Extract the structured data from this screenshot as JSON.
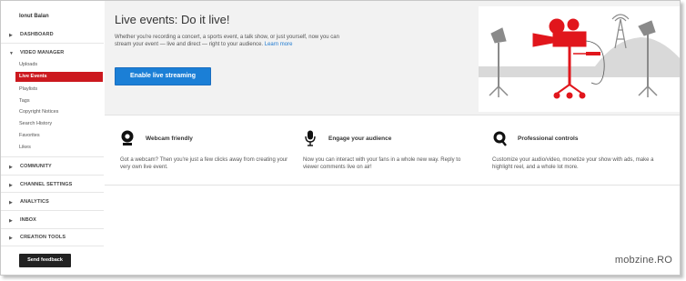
{
  "sidebar": {
    "user_name": "Ionut Balan",
    "sections": {
      "dashboard": "DASHBOARD",
      "video_manager": "VIDEO MANAGER",
      "community": "COMMUNITY",
      "channel_settings": "CHANNEL SETTINGS",
      "analytics": "ANALYTICS",
      "inbox": "INBOX",
      "creation_tools": "CREATION TOOLS"
    },
    "video_manager_items": [
      "Uploads",
      "Live Events",
      "Playlists",
      "Tags",
      "Copyright Notices",
      "Search History",
      "Favorites",
      "Likes"
    ],
    "active_item": "Live Events",
    "feedback_label": "Send feedback"
  },
  "hero": {
    "title": "Live events: Do it live!",
    "description": "Whether you're recording a concert, a sports event, a talk show, or just yourself, now you can stream your event — live and direct — right to your audience.",
    "learn_more": "Learn more",
    "button_label": "Enable live streaming"
  },
  "features": [
    {
      "title": "Webcam friendly",
      "text": "Got a webcam? Then you're just a few clicks away from creating your very own live event.",
      "icon": "webcam-icon"
    },
    {
      "title": "Engage your audience",
      "text": "Now you can interact with your fans in a whole new way. Reply to viewer comments live on air!",
      "icon": "microphone-icon"
    },
    {
      "title": "Professional controls",
      "text": "Customize your audio/video, monetize your show with ads, make a highlight reel, and a whole lot more.",
      "icon": "magnifier-icon"
    }
  ],
  "watermark": "mobzine.RO",
  "colors": {
    "accent_red": "#cc181e",
    "button_blue": "#1b7fd6",
    "link_blue": "#1f7ad0"
  }
}
